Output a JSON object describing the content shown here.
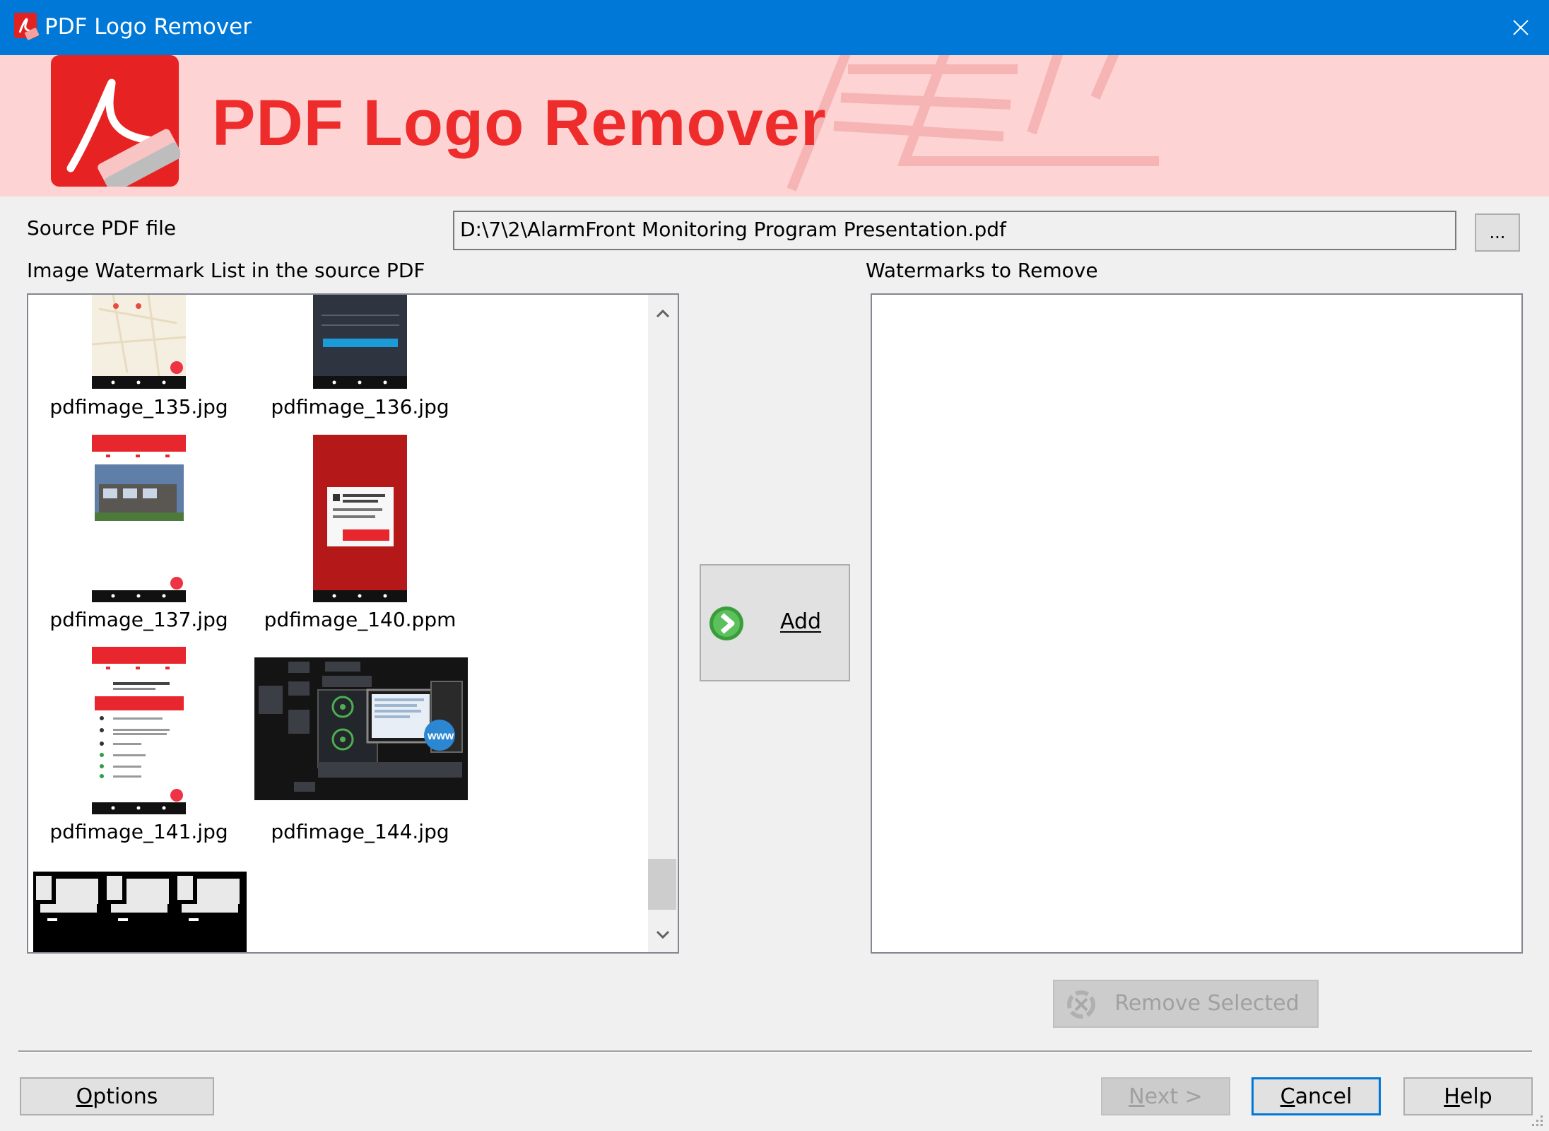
{
  "window": {
    "title": "PDF Logo Remover",
    "close_icon": "close-icon"
  },
  "banner": {
    "title": "PDF Logo Remover"
  },
  "source": {
    "label": "Source PDF file",
    "path": "D:\\7\\2\\AlarmFront Monitoring Program Presentation.pdf",
    "browse_label": "..."
  },
  "image_list": {
    "label": "Image Watermark List in the source PDF",
    "items": [
      {
        "name": "pdfimage_135.jpg"
      },
      {
        "name": "pdfimage_136.jpg"
      },
      {
        "name": "pdfimage_137.jpg"
      },
      {
        "name": "pdfimage_140.ppm"
      },
      {
        "name": "pdfimage_141.jpg"
      },
      {
        "name": "pdfimage_144.jpg"
      }
    ]
  },
  "add_button": {
    "label": "Add",
    "icon": "arrow-right-icon"
  },
  "remove_list": {
    "label": "Watermarks to Remove",
    "items": []
  },
  "remove_selected": {
    "label": "Remove Selected",
    "enabled": false
  },
  "footer": {
    "options_label": "Options",
    "next_label": "Next >",
    "cancel_label": "Cancel",
    "help_label": "Help"
  },
  "colors": {
    "titlebar": "#0078d7",
    "banner_bg": "#fdd3d3",
    "brand_red": "#ee2c2c"
  }
}
